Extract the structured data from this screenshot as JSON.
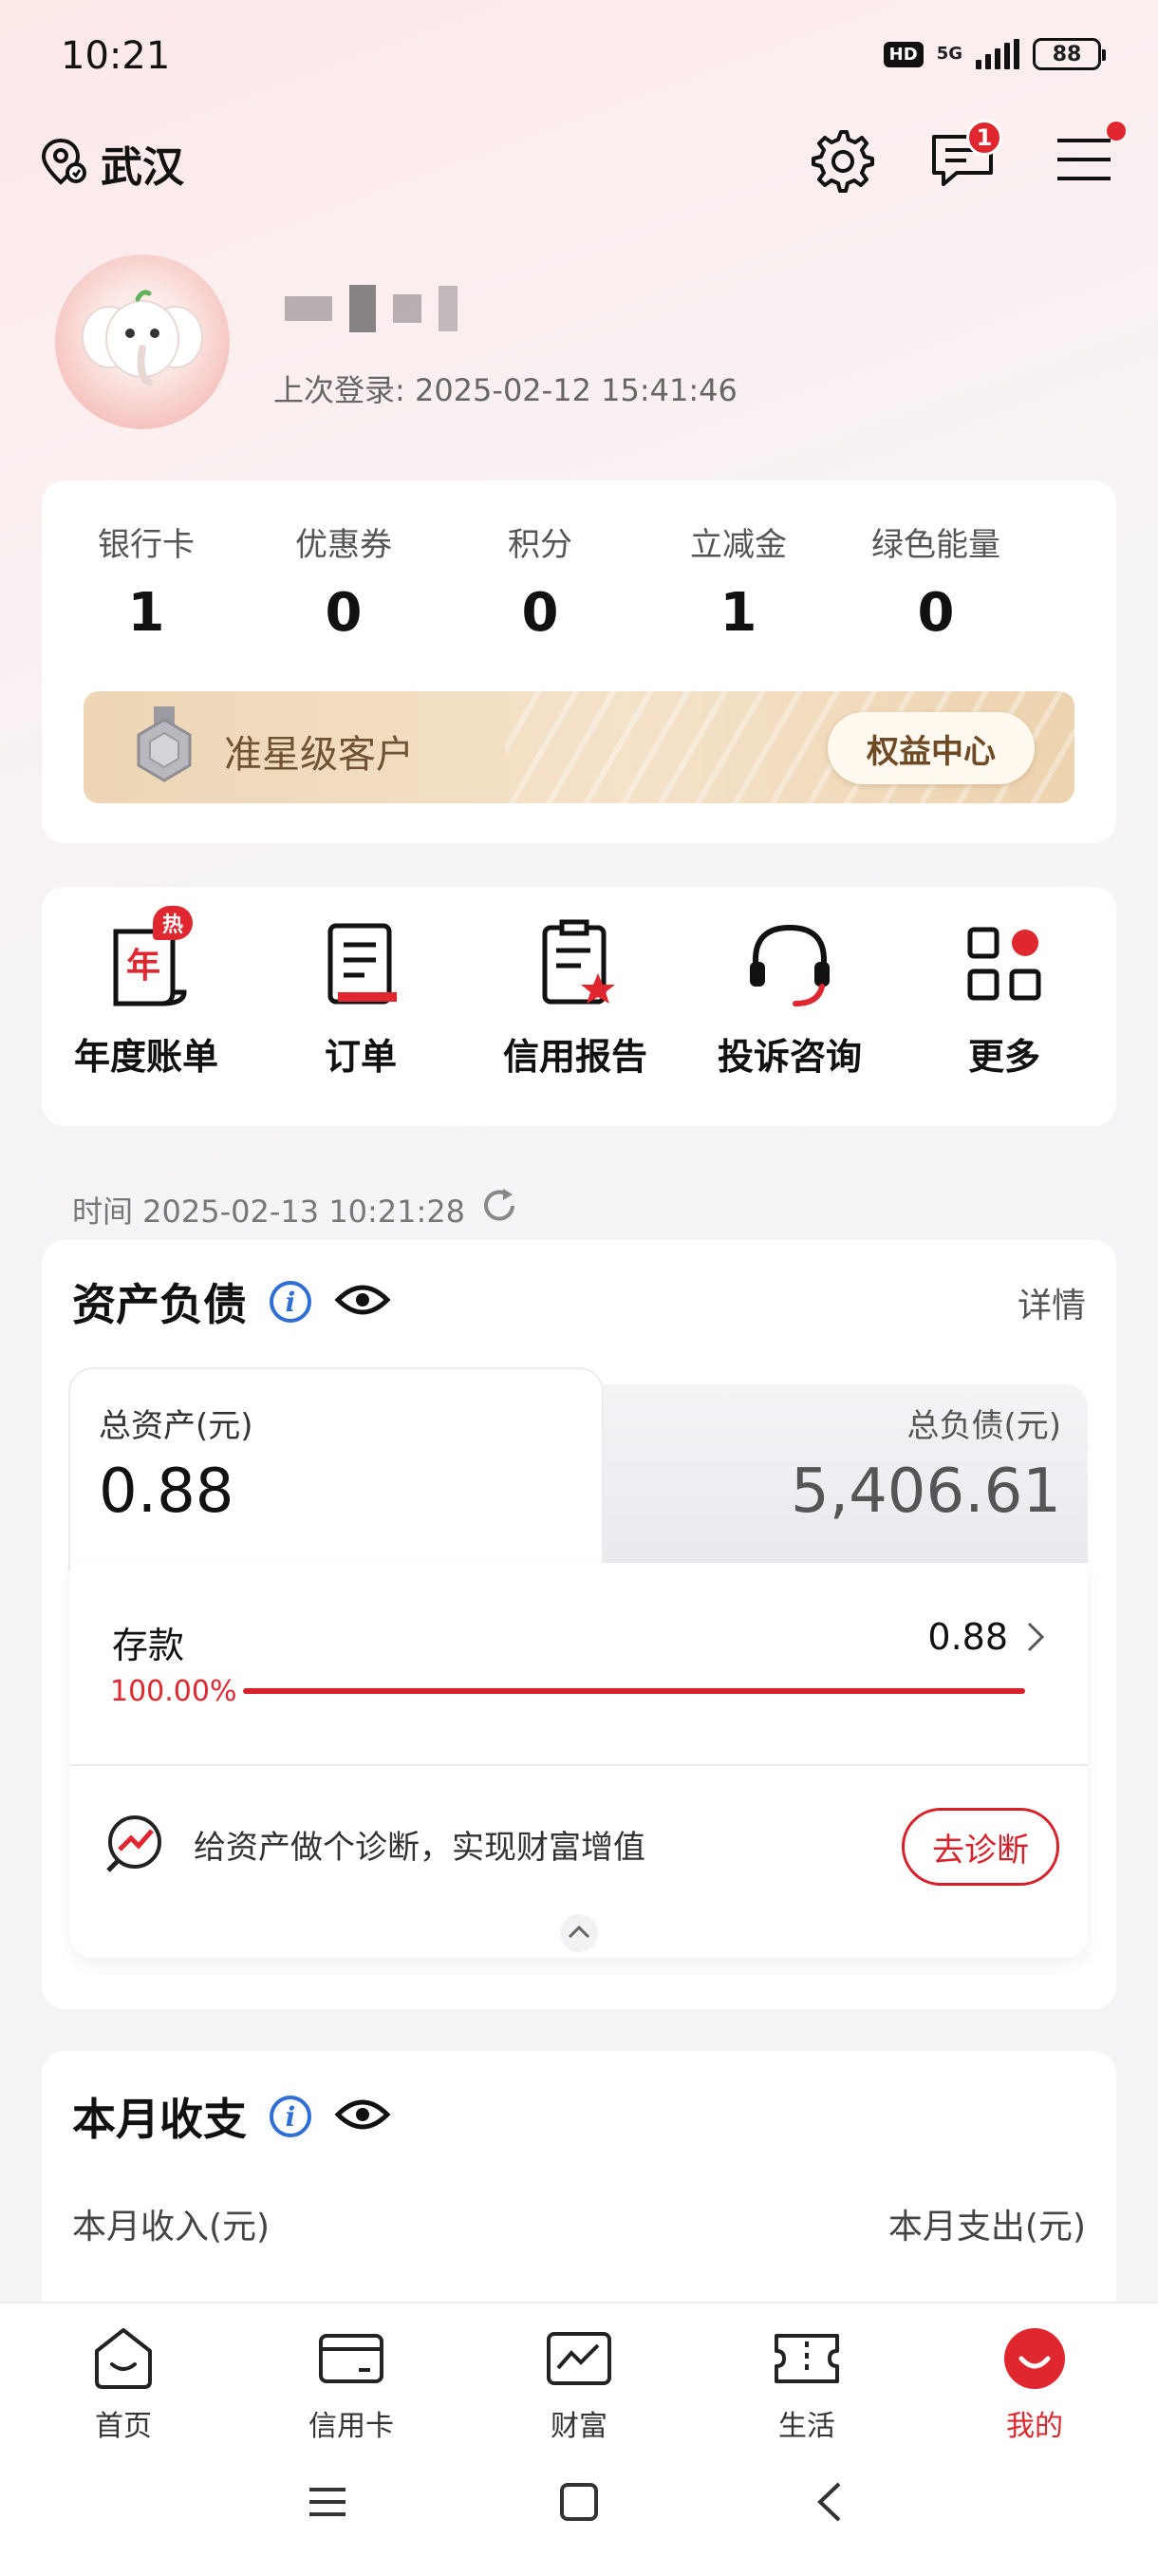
{
  "status_bar": {
    "time": "10:21",
    "hd": "HD",
    "network": "5G",
    "battery": "88"
  },
  "header": {
    "location": "武汉",
    "message_count": "1"
  },
  "profile": {
    "last_login": "上次登录: 2025-02-12 15:41:46"
  },
  "stats": [
    {
      "label": "银行卡",
      "value": "1"
    },
    {
      "label": "优惠券",
      "value": "0"
    },
    {
      "label": "积分",
      "value": "0"
    },
    {
      "label": "立减金",
      "value": "1"
    },
    {
      "label": "绿色能量",
      "value": "0"
    }
  ],
  "vip": {
    "level": "准星级客户",
    "center_button": "权益中心"
  },
  "quick_menu": [
    {
      "label": "年度账单",
      "badge": "热",
      "icon": "annual-bill-icon"
    },
    {
      "label": "订单",
      "icon": "order-icon"
    },
    {
      "label": "信用报告",
      "icon": "credit-report-icon"
    },
    {
      "label": "投诉咨询",
      "icon": "headset-icon"
    },
    {
      "label": "更多",
      "icon": "more-grid-icon"
    }
  ],
  "assets": {
    "time_label": "时间 2025-02-13 10:21:28",
    "title": "资产负债",
    "detail_link": "详情",
    "total_assets_label": "总资产(元)",
    "total_assets_value": "0.88",
    "total_liabilities_label": "总负债(元)",
    "total_liabilities_value": "5,406.61",
    "deposit_label": "存款",
    "deposit_value": "0.88",
    "deposit_percent_text": "100.00%",
    "deposit_fraction": 1.0,
    "diagnosis_text": "给资产做个诊断，实现财富增值",
    "diagnosis_button": "去诊断"
  },
  "monthly": {
    "title": "本月收支",
    "income_label": "本月收入(元)",
    "expense_label": "本月支出(元)"
  },
  "tabs": [
    {
      "label": "首页",
      "icon": "home-icon"
    },
    {
      "label": "信用卡",
      "icon": "credit-card-icon"
    },
    {
      "label": "财富",
      "icon": "chart-icon"
    },
    {
      "label": "生活",
      "icon": "ticket-icon"
    },
    {
      "label": "我的",
      "icon": "profile-icon",
      "active": true
    }
  ],
  "colors": {
    "accent": "#e0262e",
    "info_blue": "#2e6fd6",
    "vip_gold": "#eed6b5"
  }
}
